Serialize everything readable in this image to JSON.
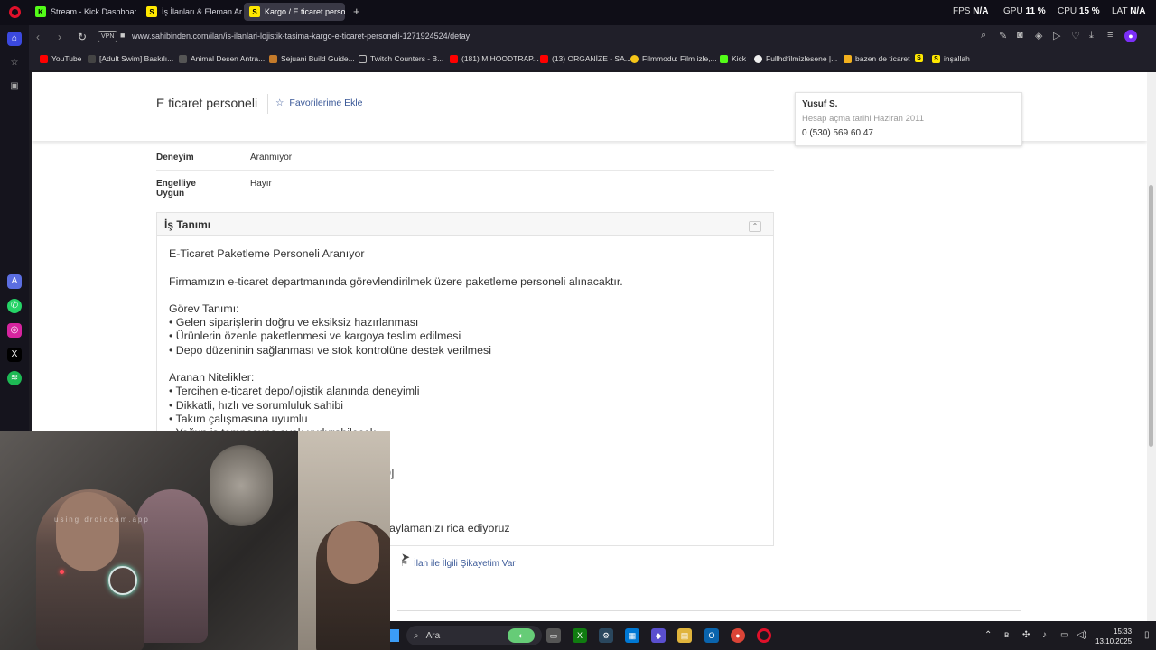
{
  "browser": {
    "tabs": [
      {
        "label": "Stream - Kick Dashboard",
        "icon": "K",
        "color": "#53fc18"
      },
      {
        "label": "İş İlanları & Eleman Arayan",
        "icon": "S",
        "color": "#ffe800"
      },
      {
        "label": "Kargo / E ticaret personel",
        "icon": "S",
        "color": "#ffe800"
      }
    ],
    "new_tab": "+",
    "stats": {
      "fps_label": "FPS",
      "fps": "N/A",
      "gpu_label": "GPU",
      "gpu": "11 %",
      "cpu_label": "CPU",
      "cpu": "15 %",
      "lat_label": "LAT",
      "lat": "N/A"
    },
    "vpn": "VPN",
    "url": "www.sahibinden.com/ilan/is-ilanlari-lojistik-tasima-kargo-e-ticaret-personeli-1271924524/detay",
    "bookmarks": [
      {
        "label": "YouTube",
        "color": "#ff0000"
      },
      {
        "label": "[Adult Swim] Baskılı...",
        "color": "#000000"
      },
      {
        "label": "Animal Desen Antra...",
        "color": "#222222"
      },
      {
        "label": "Sejuani Build Guide...",
        "color": "#c47a2a"
      },
      {
        "label": "Twitch Counters - B...",
        "color": "#000000"
      },
      {
        "label": "(181) M HOODTRAP...",
        "color": "#ff0000"
      },
      {
        "label": "(13) ORGANİZE - SA...",
        "color": "#ff0000"
      },
      {
        "label": "Filmmodu: Film izle,...",
        "color": "#f5c518"
      },
      {
        "label": "Kick",
        "color": "#53fc18"
      },
      {
        "label": "Fullhdfilmizlesene |...",
        "color": "#ffffff"
      },
      {
        "label": "bazen de ticaret",
        "color": "#f2b01e"
      },
      {
        "label": "",
        "color": "#ffe800"
      },
      {
        "label": "inşallah",
        "color": "#ffe800"
      }
    ]
  },
  "listing": {
    "title": "E ticaret personeli",
    "favorite": "Favorilerime Ekle",
    "owner": {
      "name": "Yusuf S.",
      "joined": "Hesap açma tarihi  Haziran 2011",
      "phone": "0 (530) 569 60 47"
    },
    "details": [
      {
        "key": "Deneyim",
        "value": "Aranmıyor"
      },
      {
        "key": "Engelliye Uygun",
        "value": "Hayır"
      }
    ],
    "section_title": "İş Tanımı",
    "description_lines": [
      "E-Ticaret Paketleme Personeli Aranıyor",
      "",
      "Firmamızın e-ticaret departmanında görevlendirilmek üzere paketleme personeli alınacaktır.",
      "",
      "Görev Tanımı:",
      "• Gelen siparişlerin doğru ve eksiksiz hazırlanması",
      "• Ürünlerin özenle paketlenmesi ve kargoya teslim edilmesi",
      "• Depo düzeninin sağlanması ve stok kontrolüne destek verilmesi",
      "",
      "Aranan Nitelikler:",
      "• Tercihen e-ticaret depo/lojistik alanında deneyimli",
      "• Dikkatli, hızlı ve sorumluluk sahibi",
      "• Takım çalışmasına uyumlu",
      "• Yoğun iş temposuna ayak uydurabilecek"
    ],
    "desc_fragment_1": "0]",
    "desc_fragment_2": "aylamanızı rica ediyoruz",
    "report": "İlan ile İlgili Şikayetim Var"
  },
  "webcam": {
    "watermark": "using droidcam.app"
  },
  "taskbar": {
    "search": "Ara",
    "time": "15:33",
    "date": "13.10.2025"
  }
}
